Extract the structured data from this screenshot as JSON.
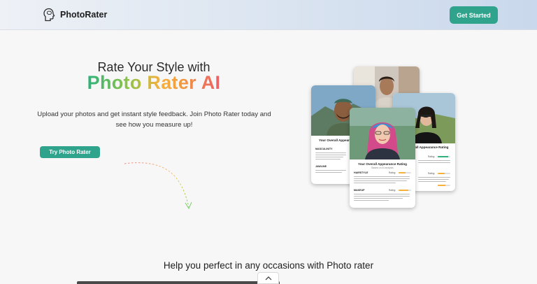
{
  "header": {
    "brand": "PhotoRater",
    "cta_label": "Get Started"
  },
  "hero": {
    "line1": "Rate Your Style with",
    "line2": "Photo Rater AI",
    "description": "Upload your photos and get instant style feedback. Join Photo Rater today and see how you measure up!",
    "try_label": "Try Photo Rater"
  },
  "cards": {
    "left": {
      "title": "Your Overall Appearance Rating",
      "sections": [
        {
          "label": "MASCULINITY"
        },
        {
          "label": "JAWLINE"
        }
      ]
    },
    "right": {
      "title": "Your Overall Appearance Rating",
      "ratings": [
        {
          "label": "Rating:",
          "fill": 0.85,
          "color": "#2fb27a"
        },
        {
          "label": "Rating:",
          "fill": 0.55,
          "color": "#f6b13b"
        },
        {
          "label": "Rating:",
          "fill": 0.6,
          "color": "#f6b13b"
        }
      ]
    },
    "center": {
      "title": "Your Overall Appearance Rating",
      "subtitle": "Based on AI analysis",
      "sections": [
        {
          "label": "HAIRSTYLE",
          "rating": "Rating:",
          "fill": 0.55,
          "color": "#f6b13b"
        },
        {
          "label": "MAKEUP",
          "rating": "Rating:",
          "fill": 0.8,
          "color": "#f6b13b"
        }
      ]
    }
  },
  "colors": {
    "accent": "#2fa38c"
  },
  "bottom": {
    "heading": "Help you perfect in any occasions with Photo rater"
  }
}
